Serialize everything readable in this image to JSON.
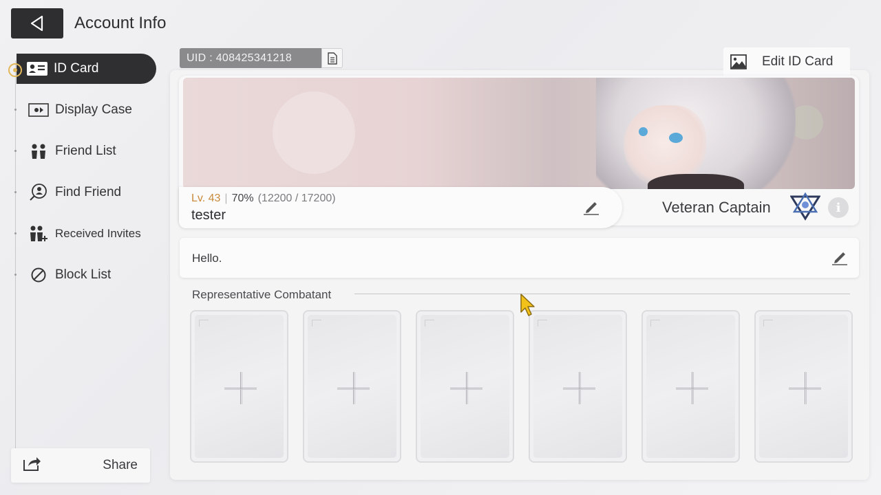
{
  "header": {
    "title": "Account Info"
  },
  "sidebar": {
    "items": [
      {
        "label": "ID Card",
        "icon": "id-card-icon",
        "active": true
      },
      {
        "label": "Display Case",
        "icon": "display-case-icon"
      },
      {
        "label": "Friend List",
        "icon": "friends-icon"
      },
      {
        "label": "Find Friend",
        "icon": "find-friend-icon"
      },
      {
        "label": "Received Invites",
        "icon": "received-invites-icon"
      },
      {
        "label": "Block List",
        "icon": "block-icon"
      }
    ],
    "share_label": "Share"
  },
  "profile": {
    "uid": "UID : 408425341218",
    "edit_card_label": "Edit ID Card",
    "level": "Lv. 43",
    "separator": "|",
    "exp_percent": "70%",
    "exp_ratio": "(12200 / 17200)",
    "username": "tester",
    "title": "Veteran Captain",
    "greeting": "Hello."
  },
  "combatants": {
    "section_label": "Representative Combatant",
    "slots": 6
  },
  "colors": {
    "accent": "#e2b85a",
    "dark": "#2f2f32",
    "level": "#c9893a"
  }
}
